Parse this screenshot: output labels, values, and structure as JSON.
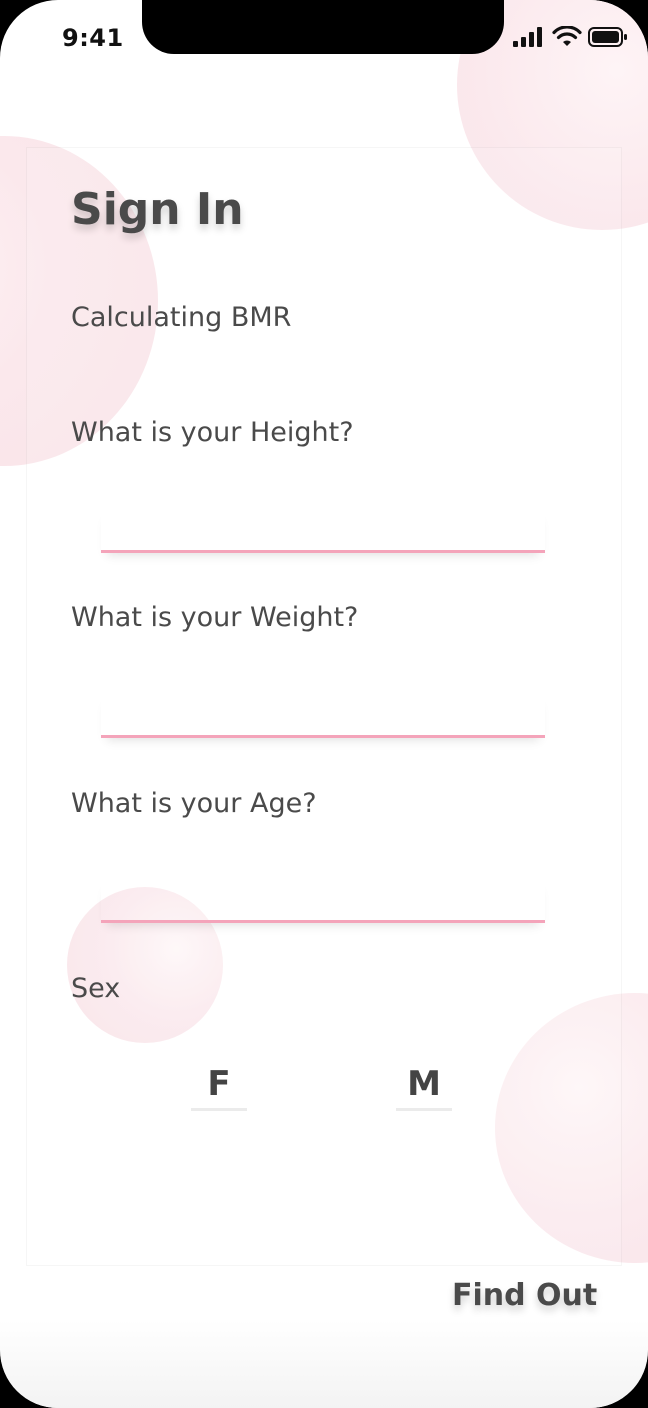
{
  "status_bar": {
    "time": "9:41",
    "icons": [
      "signal-icon",
      "wifi-icon",
      "battery-icon"
    ]
  },
  "screen": {
    "title": "Sign In",
    "subtitle": "Calculating BMR"
  },
  "form": {
    "height_label": "What is your Height?",
    "height_value": "",
    "weight_label": "What is your Weight?",
    "weight_value": "",
    "age_label": "What is your Age?",
    "age_value": "",
    "sex_label": "Sex",
    "sex_options": [
      "F",
      "M"
    ]
  },
  "actions": {
    "submit_label": "Find Out"
  },
  "colors": {
    "accent": "#f4a4ba",
    "text": "#4a4a4a",
    "bubble": "#f9e3e8"
  }
}
